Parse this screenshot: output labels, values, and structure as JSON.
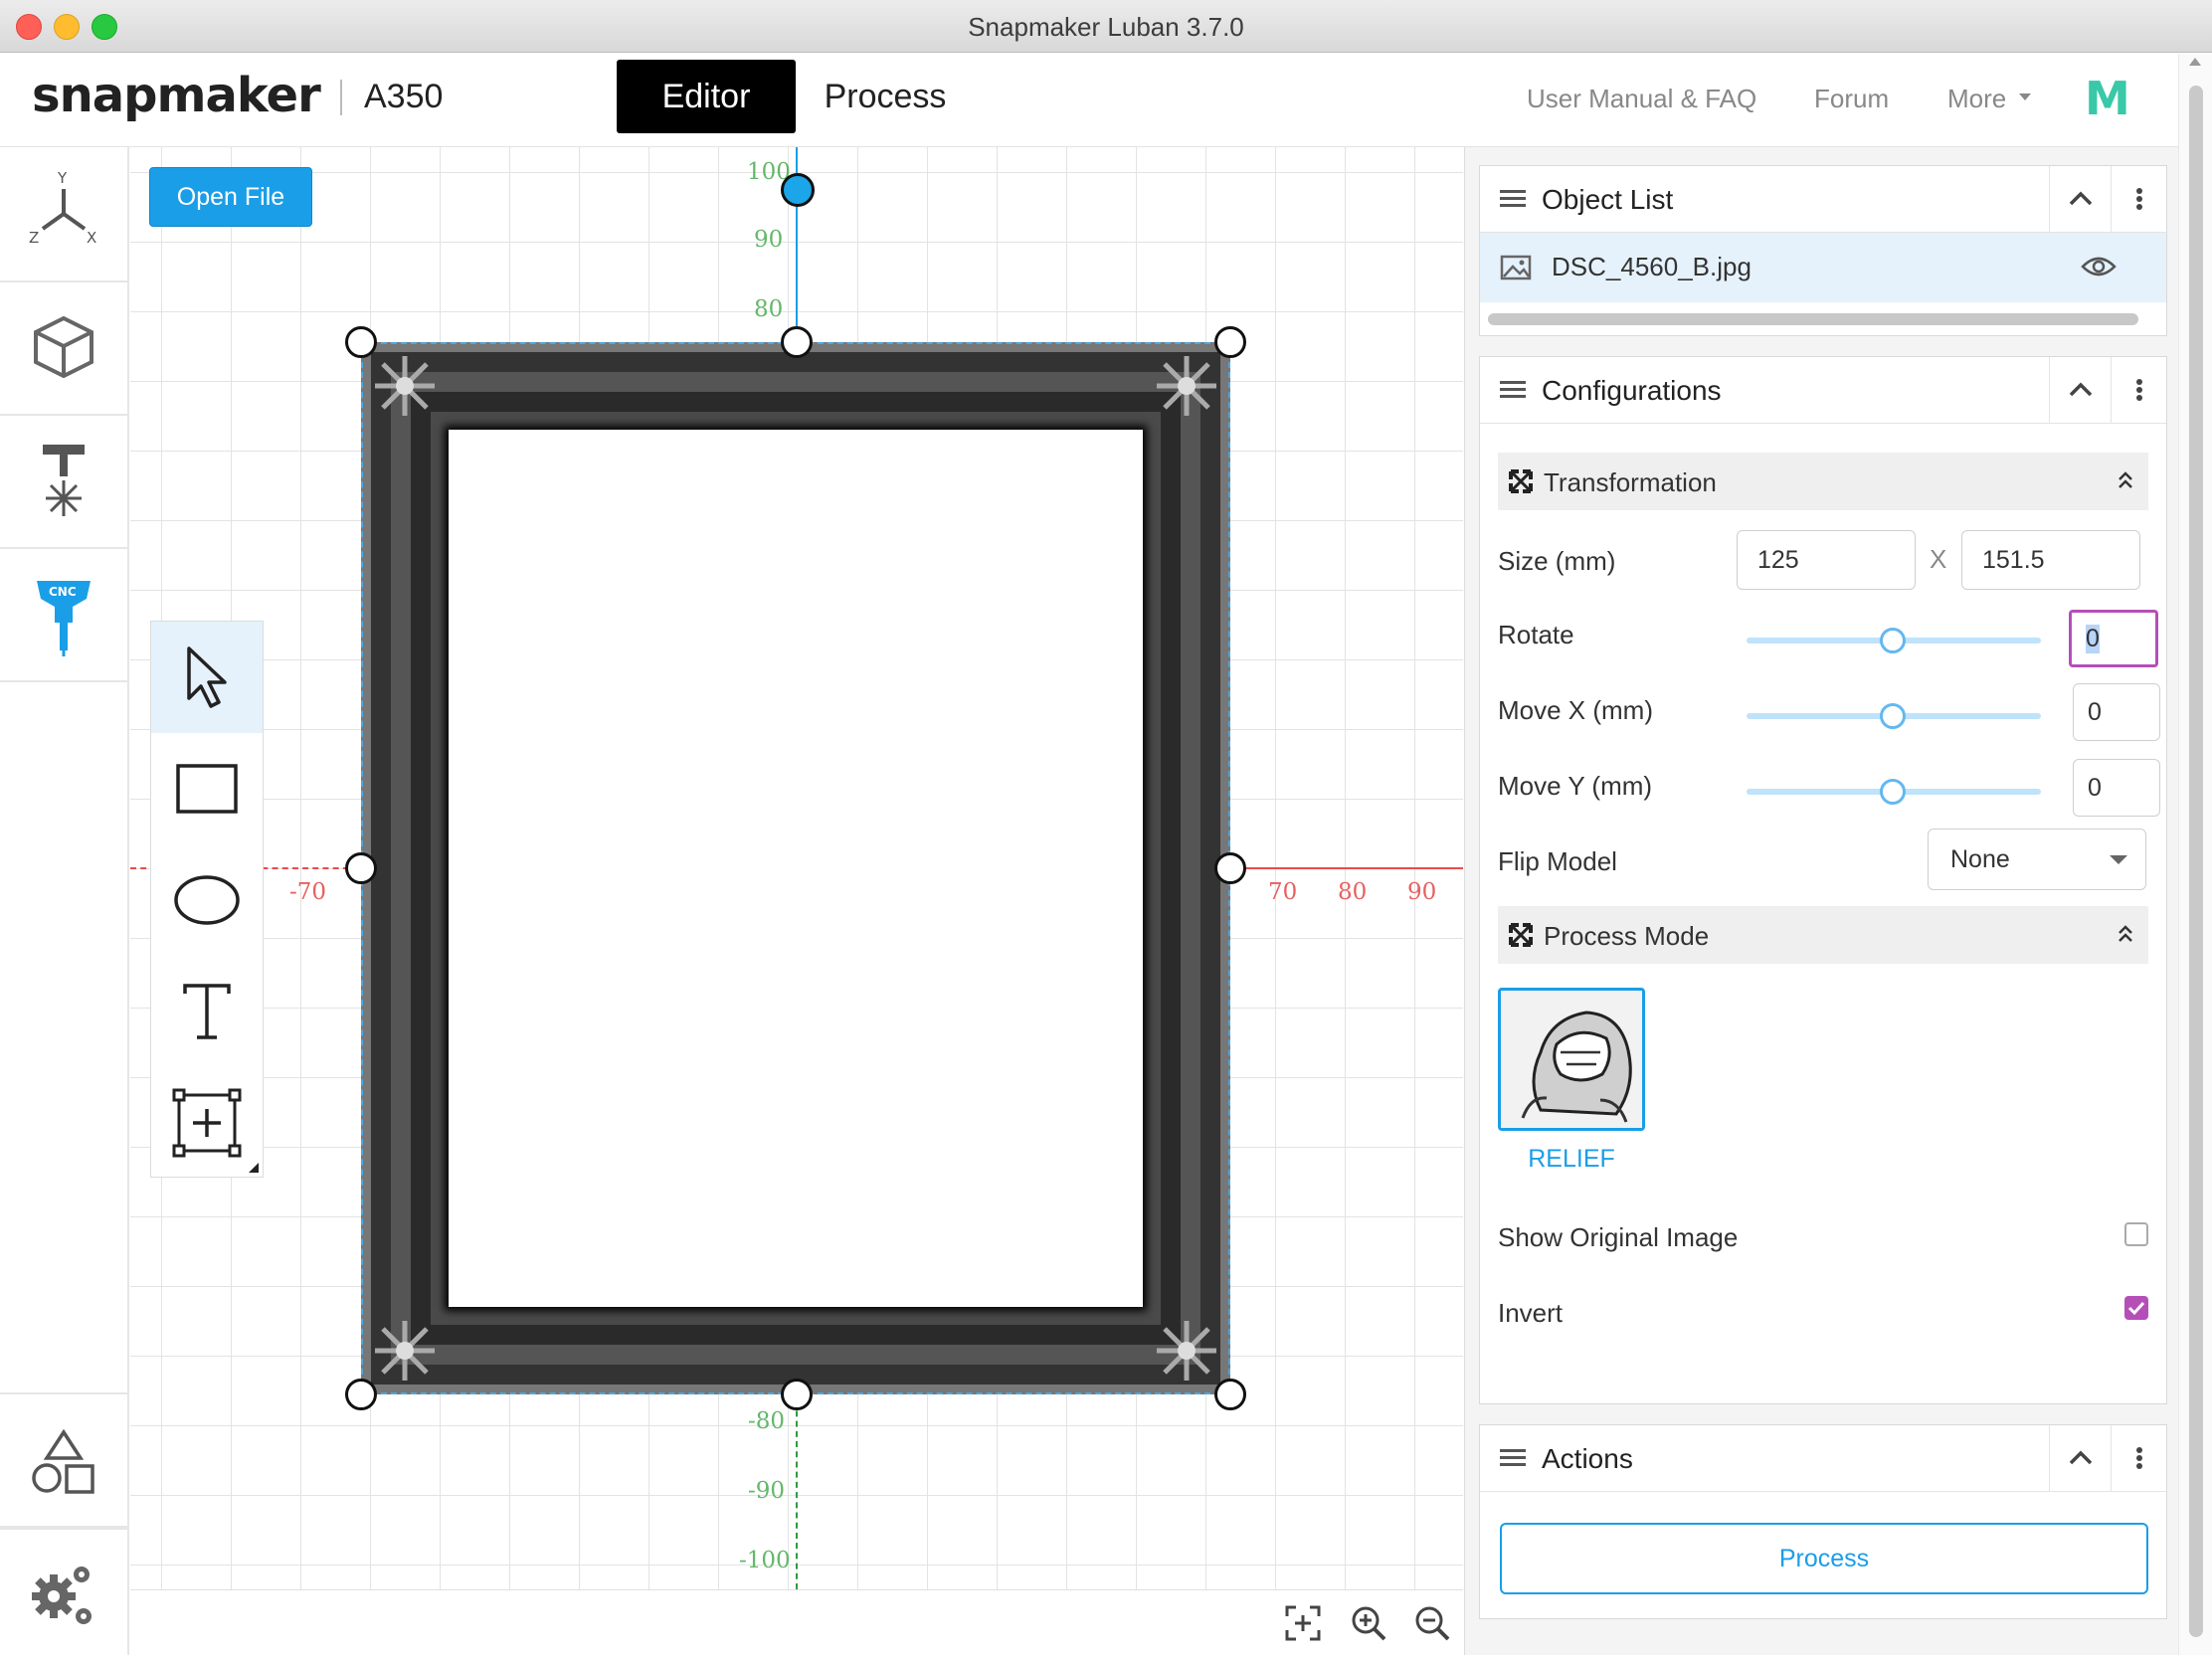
{
  "window": {
    "title": "Snapmaker Luban 3.7.0"
  },
  "header": {
    "logo": "snapmaker",
    "model": "A350",
    "tabs": [
      {
        "label": "Editor",
        "active": true
      },
      {
        "label": "Process",
        "active": false
      }
    ],
    "links": {
      "manual": "User Manual & FAQ",
      "forum": "Forum",
      "more": "More",
      "brand_icon": "M"
    }
  },
  "sidebar": {
    "items": [
      {
        "icon": "axes-icon",
        "labels": [
          "Y",
          "Z",
          "X"
        ]
      },
      {
        "icon": "cube-icon"
      },
      {
        "icon": "laser-icon"
      },
      {
        "icon": "cnc-icon",
        "badge": "CNC",
        "active": true
      },
      {
        "icon": "shapes-icon"
      },
      {
        "icon": "settings-gears-icon"
      }
    ]
  },
  "canvas": {
    "open_file": "Open File",
    "y_ticks_top": [
      "100",
      "90",
      "80"
    ],
    "y_ticks_bottom": [
      "-80",
      "-90",
      "-100"
    ],
    "x_ticks_left": [
      "-70"
    ],
    "x_ticks_right": [
      "70",
      "80",
      "90"
    ],
    "tools": [
      "select-tool",
      "rectangle-tool",
      "ellipse-tool",
      "text-tool",
      "insert-tool"
    ],
    "zoom_controls": [
      "fit-view-icon",
      "zoom-in-icon",
      "zoom-out-icon"
    ]
  },
  "object_list": {
    "title": "Object List",
    "items": [
      {
        "name": "DSC_4560_B.jpg",
        "visible": true
      }
    ]
  },
  "configurations": {
    "title": "Configurations",
    "transformation": {
      "title": "Transformation",
      "size_label": "Size (mm)",
      "width": "125",
      "separator": "X",
      "height": "151.5",
      "rotate_label": "Rotate",
      "rotate": "0",
      "move_x_label": "Move X (mm)",
      "move_x": "0",
      "move_y_label": "Move Y (mm)",
      "move_y": "0",
      "flip_label": "Flip Model",
      "flip": "None"
    },
    "process_mode": {
      "title": "Process Mode",
      "mode": "RELIEF",
      "show_original_label": "Show Original Image",
      "show_original": false,
      "invert_label": "Invert",
      "invert": true
    }
  },
  "actions": {
    "title": "Actions",
    "process_button": "Process"
  },
  "colors": {
    "accent": "#1a9ee8",
    "y_axis": "#64b86a",
    "x_axis": "#e84c4c",
    "checkbox": "#b44fb8",
    "active_tab": "#000000"
  }
}
